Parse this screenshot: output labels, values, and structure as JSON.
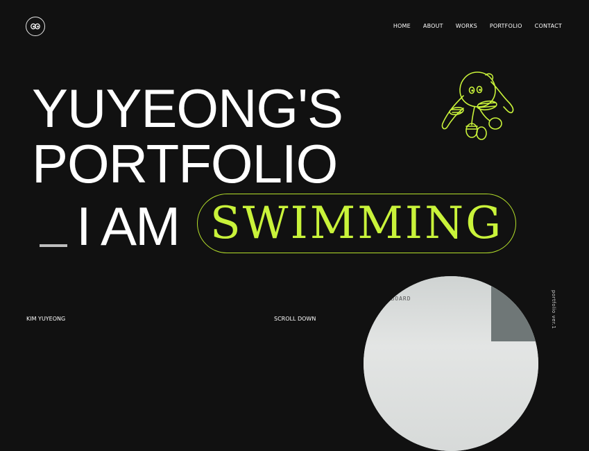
{
  "nav": {
    "items": [
      "HOME",
      "ABOUT",
      "WORKS",
      "PORTFOLIO",
      "CONTACT"
    ]
  },
  "hero": {
    "line1": "YUYEONG'S",
    "line2": "PORTFOLIO",
    "line3_prefix": "I AM",
    "highlight": "SWIMMING"
  },
  "footer": {
    "name": "KIM YUYEONG",
    "scroll": "SCROLL DOWN",
    "version": "portfolio ver.1"
  },
  "photo": {
    "board_title": "ORYBOARD"
  },
  "colors": {
    "background": "#111111",
    "accent": "#c9f33a",
    "text": "#ffffff"
  }
}
